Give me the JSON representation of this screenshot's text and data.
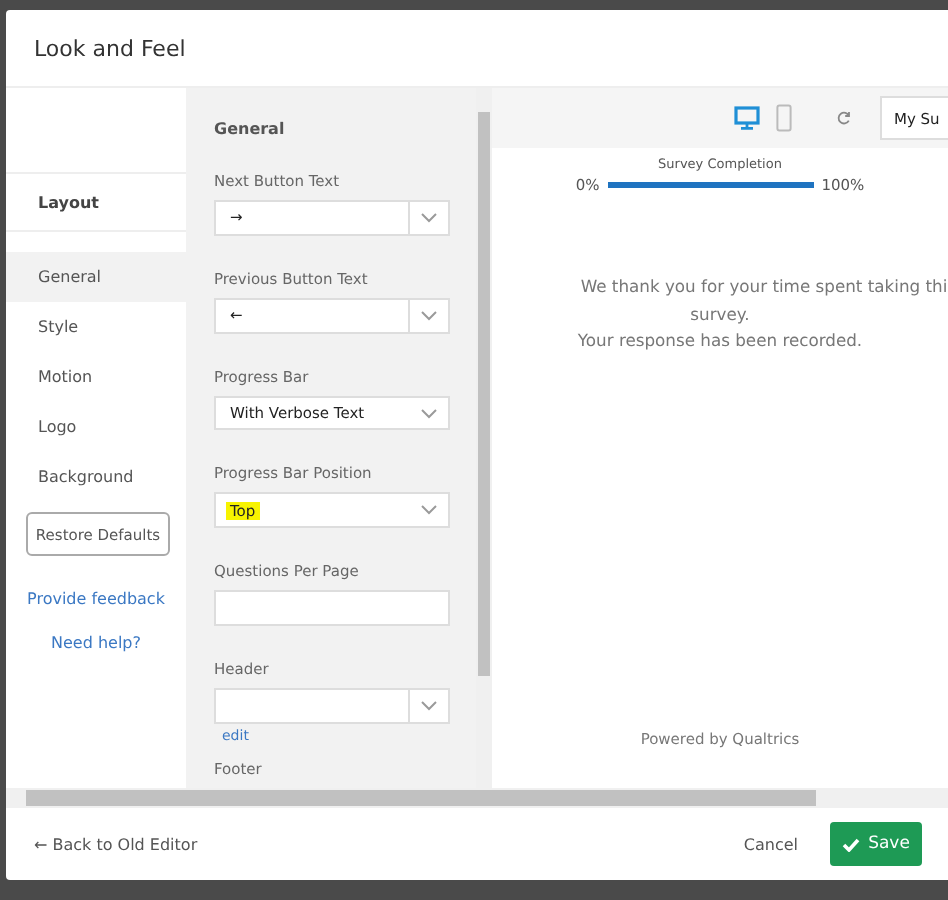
{
  "dialog": {
    "title": "Look and Feel"
  },
  "nav": {
    "section": "Layout",
    "items": [
      {
        "label": "General",
        "selected": true
      },
      {
        "label": "Style",
        "selected": false
      },
      {
        "label": "Motion",
        "selected": false
      },
      {
        "label": "Logo",
        "selected": false
      },
      {
        "label": "Background",
        "selected": false
      }
    ],
    "restore_button": "Restore Defaults",
    "feedback_link": "Provide feedback",
    "help_link": "Need help?"
  },
  "settings": {
    "heading": "General",
    "fields": [
      {
        "label": "Next Button Text",
        "kind": "combo",
        "value": "→",
        "highlighted": false
      },
      {
        "label": "Previous Button Text",
        "kind": "combo",
        "value": "←",
        "highlighted": false
      },
      {
        "label": "Progress Bar",
        "kind": "select",
        "value": "With Verbose Text",
        "highlighted": false
      },
      {
        "label": "Progress Bar Position",
        "kind": "select",
        "value": "Top",
        "highlighted": true
      },
      {
        "label": "Questions Per Page",
        "kind": "input"
      },
      {
        "label": "Header",
        "kind": "combo",
        "link": "edit"
      },
      {
        "label": "Footer",
        "kind": "label"
      }
    ]
  },
  "preview": {
    "devices": [
      {
        "kind": "desktop",
        "selected": true
      },
      {
        "kind": "mobile",
        "selected": false
      }
    ],
    "survey_select": "My Su",
    "progress_title": "Survey Completion",
    "progress_start": "0%",
    "progress_end": "100%",
    "level": 1,
    "message": [
      "We thank you for your time spent taking thi",
      "survey.",
      "Your response has been recorded."
    ],
    "powered_by": "Powered by Qualtrics"
  },
  "footer": {
    "back_link": "← Back to Old Editor",
    "cancel": "Cancel",
    "save": "Save"
  }
}
